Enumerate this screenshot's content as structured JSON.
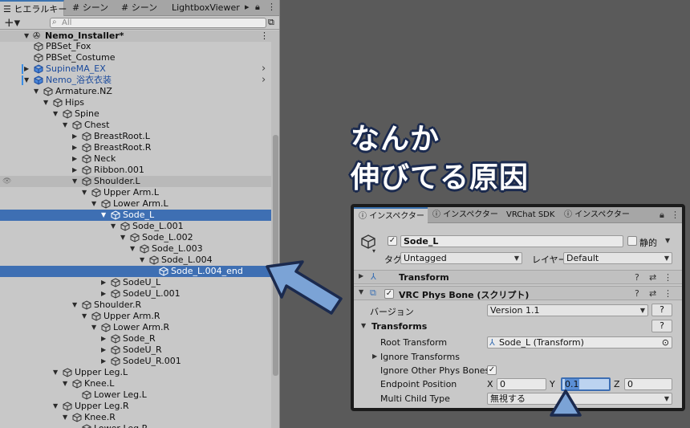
{
  "hierarchy": {
    "tabs": {
      "hierarchy": "ヒエラルキー",
      "scene1": "シーン",
      "scene2": "シーン",
      "lightbox": "LightboxViewer"
    },
    "toolbar": {
      "add": "+▾",
      "search_placeholder": "All"
    },
    "root": "Nemo_Installer*",
    "rows": [
      {
        "label": "PBSet_Fox",
        "depth": 2,
        "arrow": "",
        "icon": "cube-icon"
      },
      {
        "label": "PBSet_Costume",
        "depth": 2,
        "arrow": "",
        "icon": "cube-icon"
      },
      {
        "label": "SupineMA_EX",
        "depth": 2,
        "arrow": "▶",
        "icon": "prefab-icon"
      },
      {
        "label": "Nemo_浴衣衣装",
        "depth": 2,
        "arrow": "▼",
        "icon": "prefab-icon"
      },
      {
        "label": "Armature.NZ",
        "depth": 3,
        "arrow": "▼",
        "icon": "cube-icon"
      },
      {
        "label": "Hips",
        "depth": 4,
        "arrow": "▼",
        "icon": "cube-icon"
      },
      {
        "label": "Spine",
        "depth": 5,
        "arrow": "▼",
        "icon": "cube-icon"
      },
      {
        "label": "Chest",
        "depth": 6,
        "arrow": "▼",
        "icon": "cube-icon"
      },
      {
        "label": "BreastRoot.L",
        "depth": 7,
        "arrow": "▶",
        "icon": "cube-icon"
      },
      {
        "label": "BreastRoot.R",
        "depth": 7,
        "arrow": "▶",
        "icon": "cube-icon"
      },
      {
        "label": "Neck",
        "depth": 7,
        "arrow": "▶",
        "icon": "cube-icon"
      },
      {
        "label": "Ribbon.001",
        "depth": 7,
        "arrow": "▶",
        "icon": "cube-icon"
      },
      {
        "label": "Shoulder.L",
        "depth": 7,
        "arrow": "▼",
        "icon": "cube-icon"
      },
      {
        "label": "Upper Arm.L",
        "depth": 8,
        "arrow": "▼",
        "icon": "cube-icon"
      },
      {
        "label": "Lower Arm.L",
        "depth": 9,
        "arrow": "▼",
        "icon": "cube-icon"
      },
      {
        "label": "Sode_L",
        "depth": 10,
        "arrow": "▼",
        "icon": "cube-icon"
      },
      {
        "label": "Sode_L.001",
        "depth": 11,
        "arrow": "▼",
        "icon": "cube-icon"
      },
      {
        "label": "Sode_L.002",
        "depth": 12,
        "arrow": "▼",
        "icon": "cube-icon"
      },
      {
        "label": "Sode_L.003",
        "depth": 13,
        "arrow": "▼",
        "icon": "cube-icon"
      },
      {
        "label": "Sode_L.004",
        "depth": 14,
        "arrow": "▼",
        "icon": "cube-icon"
      },
      {
        "label": "Sode_L.004_end",
        "depth": 15,
        "arrow": "",
        "icon": "cube-icon"
      },
      {
        "label": "SodeU_L",
        "depth": 10,
        "arrow": "▶",
        "icon": "cube-icon"
      },
      {
        "label": "SodeU_L.001",
        "depth": 10,
        "arrow": "▶",
        "icon": "cube-icon"
      },
      {
        "label": "Shoulder.R",
        "depth": 7,
        "arrow": "▼",
        "icon": "cube-icon"
      },
      {
        "label": "Upper Arm.R",
        "depth": 8,
        "arrow": "▼",
        "icon": "cube-icon"
      },
      {
        "label": "Lower Arm.R",
        "depth": 9,
        "arrow": "▼",
        "icon": "cube-icon"
      },
      {
        "label": "Sode_R",
        "depth": 10,
        "arrow": "▶",
        "icon": "cube-icon"
      },
      {
        "label": "SodeU_R",
        "depth": 10,
        "arrow": "▶",
        "icon": "cube-icon"
      },
      {
        "label": "SodeU_R.001",
        "depth": 10,
        "arrow": "▶",
        "icon": "cube-icon"
      },
      {
        "label": "Upper Leg.L",
        "depth": 5,
        "arrow": "▼",
        "icon": "cube-icon"
      },
      {
        "label": "Knee.L",
        "depth": 6,
        "arrow": "▼",
        "icon": "cube-icon"
      },
      {
        "label": "Lower Leg.L",
        "depth": 7,
        "arrow": "",
        "icon": "cube-icon"
      },
      {
        "label": "Upper Leg.R",
        "depth": 5,
        "arrow": "▼",
        "icon": "cube-icon"
      },
      {
        "label": "Knee.R",
        "depth": 6,
        "arrow": "▼",
        "icon": "cube-icon"
      },
      {
        "label": "Lower Leg.R",
        "depth": 7,
        "arrow": "",
        "icon": "cube-icon"
      }
    ],
    "selected_rows": [
      "Sode_L",
      "Sode_L.004_end"
    ],
    "highlighted_rows": [
      "Shoulder.L"
    ]
  },
  "annotation": {
    "line1": "なんか",
    "line2": "伸びてる原因"
  },
  "inspector": {
    "tabs": {
      "inspector1": "インスペクター",
      "inspector2": "インスペクター",
      "vrchat": "VRChat SDK",
      "inspector3": "インスペクター"
    },
    "object_name": "Sode_L",
    "static_label": "静的",
    "tag_label": "タグ",
    "tag_value": "Untagged",
    "layer_label": "レイヤー",
    "layer_value": "Default",
    "component_transform": "Transform",
    "component_physbone": "VRC Phys Bone (スクリプト)",
    "version_label": "バージョン",
    "version_value": "Version 1.1",
    "help_btn": "?",
    "transforms_section": "Transforms",
    "root_transform_label": "Root Transform",
    "root_transform_value": "Sode_L (Transform)",
    "ignore_transforms_label": "Ignore Transforms",
    "ignore_other_label": "Ignore Other Phys Bones",
    "endpoint_label": "Endpoint Position",
    "x_label": "X",
    "x_value": "0",
    "y_label": "Y",
    "y_value": "0.1",
    "z_label": "Z",
    "z_value": "0",
    "multi_child_label": "Multi Child Type",
    "multi_child_value": "無視する"
  },
  "colors": {
    "selection": "#3e6fb3",
    "arrow_fill": "#7ba3d6",
    "arrow_stroke": "#1b2a4e"
  }
}
